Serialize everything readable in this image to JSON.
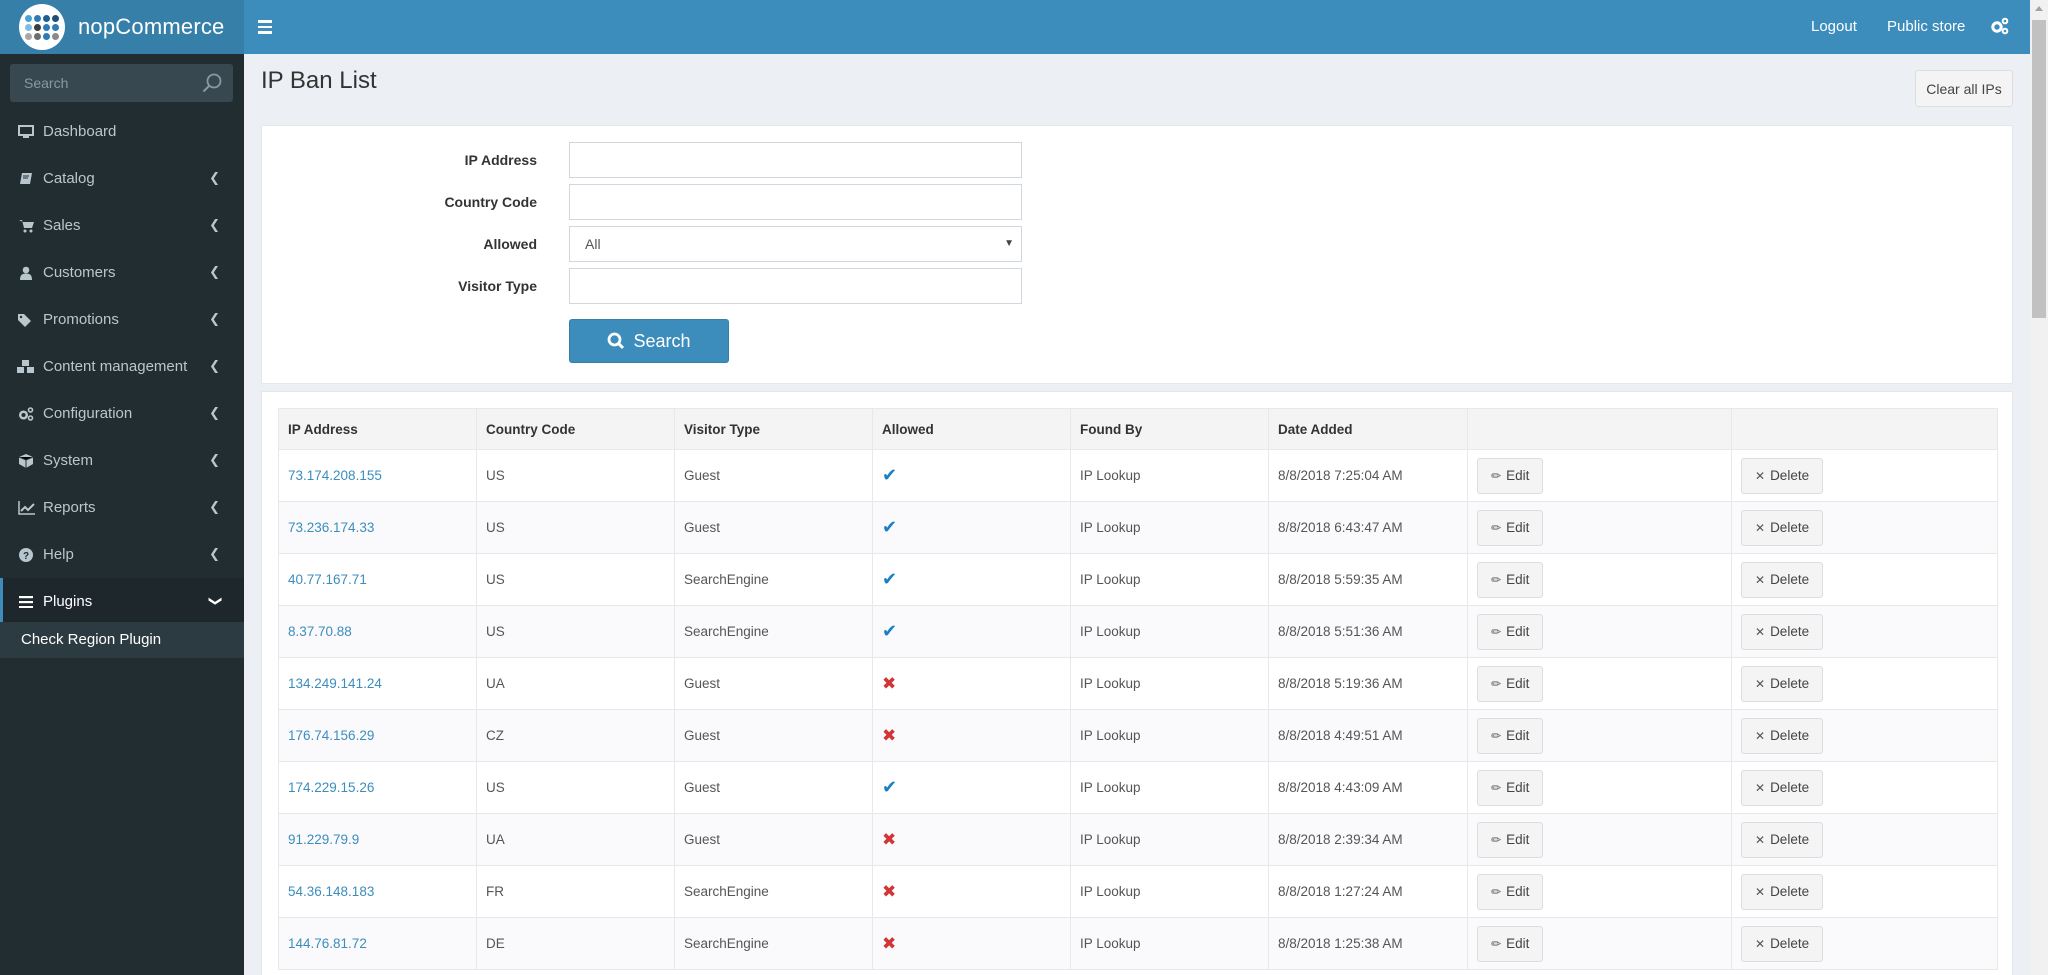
{
  "brand": {
    "name": "nopCommerce",
    "logo_dots": [
      "#4aa3d8",
      "#2c7cb8",
      "#1d5f93",
      "#1d4f7a",
      "#7fbbe0",
      "#3d3d3d",
      "#2c7cb8",
      "#2c7cb8",
      "#a8a8a8",
      "#6e6e6e",
      "#2c7cb8",
      "#8a8a8a"
    ]
  },
  "header": {
    "menu_toggle": "menu-toggle",
    "links": [
      {
        "label": "Logout"
      },
      {
        "label": "Public store"
      }
    ],
    "settings_icon": "gears-icon"
  },
  "sidebar": {
    "search_placeholder": "Search",
    "items": [
      {
        "label": "Dashboard",
        "icon": "desktop-icon",
        "has_chevron": false
      },
      {
        "label": "Catalog",
        "icon": "book-icon",
        "has_chevron": true
      },
      {
        "label": "Sales",
        "icon": "shopping-cart-icon",
        "has_chevron": true
      },
      {
        "label": "Customers",
        "icon": "user-icon",
        "has_chevron": true
      },
      {
        "label": "Promotions",
        "icon": "tags-icon",
        "has_chevron": true
      },
      {
        "label": "Content management",
        "icon": "cubes-icon",
        "has_chevron": true
      },
      {
        "label": "Configuration",
        "icon": "gears-icon",
        "has_chevron": true
      },
      {
        "label": "System",
        "icon": "cube-icon",
        "has_chevron": true
      },
      {
        "label": "Reports",
        "icon": "line-chart-icon",
        "has_chevron": true
      },
      {
        "label": "Help",
        "icon": "question-circle-icon",
        "has_chevron": true
      },
      {
        "label": "Plugins",
        "icon": "bars-icon",
        "has_chevron": true,
        "expanded": true
      }
    ],
    "sub_items": [
      {
        "label": "Check Region Plugin"
      }
    ]
  },
  "page": {
    "title": "IP Ban List",
    "clear_button": "Clear all IPs"
  },
  "search_form": {
    "fields": [
      {
        "label": "IP Address",
        "value": "",
        "type": "text"
      },
      {
        "label": "Country Code",
        "value": "",
        "type": "text"
      },
      {
        "label": "Allowed",
        "value": "All",
        "type": "select"
      },
      {
        "label": "Visitor Type",
        "value": "",
        "type": "text"
      }
    ],
    "search_button": "Search"
  },
  "table": {
    "columns": [
      "IP Address",
      "Country Code",
      "Visitor Type",
      "Allowed",
      "Found By",
      "Date Added",
      "",
      ""
    ],
    "edit_label": "Edit",
    "delete_label": "Delete",
    "rows": [
      {
        "ip": "73.174.208.155",
        "country": "US",
        "visitor_type": "Guest",
        "allowed": true,
        "found_by": "IP Lookup",
        "date_added": "8/8/2018 7:25:04 AM"
      },
      {
        "ip": "73.236.174.33",
        "country": "US",
        "visitor_type": "Guest",
        "allowed": true,
        "found_by": "IP Lookup",
        "date_added": "8/8/2018 6:43:47 AM"
      },
      {
        "ip": "40.77.167.71",
        "country": "US",
        "visitor_type": "SearchEngine",
        "allowed": true,
        "found_by": "IP Lookup",
        "date_added": "8/8/2018 5:59:35 AM"
      },
      {
        "ip": "8.37.70.88",
        "country": "US",
        "visitor_type": "SearchEngine",
        "allowed": true,
        "found_by": "IP Lookup",
        "date_added": "8/8/2018 5:51:36 AM"
      },
      {
        "ip": "134.249.141.24",
        "country": "UA",
        "visitor_type": "Guest",
        "allowed": false,
        "found_by": "IP Lookup",
        "date_added": "8/8/2018 5:19:36 AM"
      },
      {
        "ip": "176.74.156.29",
        "country": "CZ",
        "visitor_type": "Guest",
        "allowed": false,
        "found_by": "IP Lookup",
        "date_added": "8/8/2018 4:49:51 AM"
      },
      {
        "ip": "174.229.15.26",
        "country": "US",
        "visitor_type": "Guest",
        "allowed": true,
        "found_by": "IP Lookup",
        "date_added": "8/8/2018 4:43:09 AM"
      },
      {
        "ip": "91.229.79.9",
        "country": "UA",
        "visitor_type": "Guest",
        "allowed": false,
        "found_by": "IP Lookup",
        "date_added": "8/8/2018 2:39:34 AM"
      },
      {
        "ip": "54.36.148.183",
        "country": "FR",
        "visitor_type": "SearchEngine",
        "allowed": false,
        "found_by": "IP Lookup",
        "date_added": "8/8/2018 1:27:24 AM"
      },
      {
        "ip": "144.76.81.72",
        "country": "DE",
        "visitor_type": "SearchEngine",
        "allowed": false,
        "found_by": "IP Lookup",
        "date_added": "8/8/2018 1:25:38 AM"
      }
    ]
  },
  "colors": {
    "header": "#3c8dbc",
    "logo_bg": "#367fa9",
    "sidebar": "#222d32",
    "allowed_true": "#1a7fc4",
    "allowed_false": "#d13535"
  }
}
